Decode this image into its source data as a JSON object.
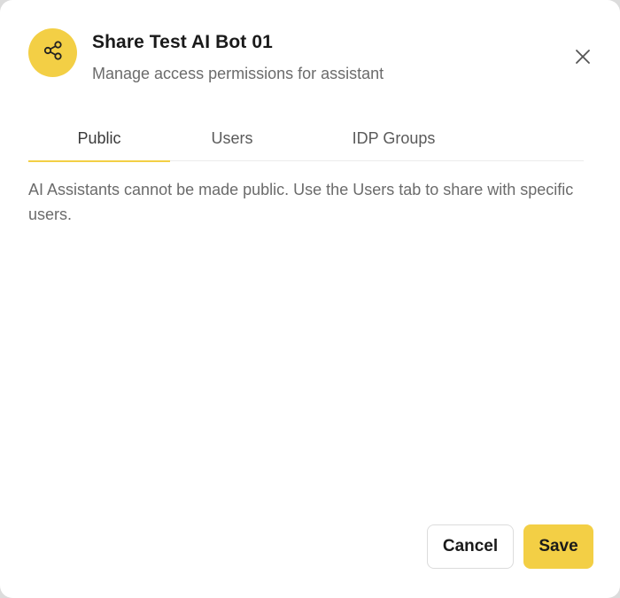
{
  "dialog": {
    "title": "Share Test AI Bot 01",
    "subtitle": "Manage access permissions for assistant",
    "icon": "share-icon",
    "close_icon": "close-icon",
    "accent_color": "#f3cf45"
  },
  "tabs": [
    {
      "label": "Public",
      "active": true
    },
    {
      "label": "Users",
      "active": false
    },
    {
      "label": "IDP Groups",
      "active": false
    }
  ],
  "content": {
    "message": "AI Assistants cannot be made public. Use the Users tab to share with specific users."
  },
  "footer": {
    "cancel_label": "Cancel",
    "save_label": "Save"
  }
}
